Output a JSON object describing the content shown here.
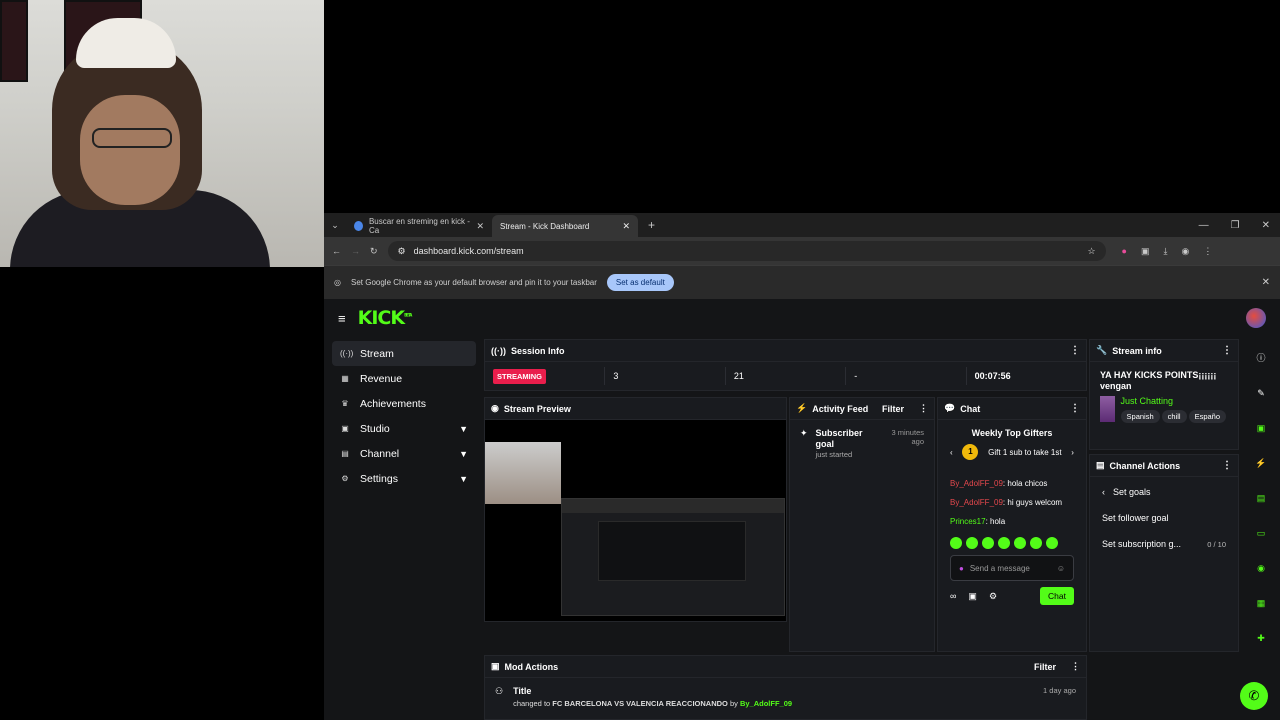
{
  "browser": {
    "tabs": [
      {
        "title": "Buscar en streming en kick - Ca",
        "active": false
      },
      {
        "title": "Stream - Kick Dashboard",
        "active": true
      }
    ],
    "url": "dashboard.kick.com/stream",
    "notice_text": "Set Google Chrome as your default browser and pin it to your taskbar",
    "notice_button": "Set as default"
  },
  "kick": {
    "logo": "KICK",
    "logo_badge": "BETA",
    "sidebar": [
      {
        "label": "Stream",
        "icon": "radio-icon",
        "active": true
      },
      {
        "label": "Revenue",
        "icon": "chart-icon"
      },
      {
        "label": "Achievements",
        "icon": "trophy-icon"
      },
      {
        "label": "Studio",
        "icon": "studio-icon",
        "expand": true
      },
      {
        "label": "Channel",
        "icon": "channel-icon",
        "expand": true
      },
      {
        "label": "Settings",
        "icon": "gear-icon",
        "expand": true
      }
    ],
    "session": {
      "title": "Session Info",
      "status": "STREAMING",
      "viewers": "3",
      "followers": "21",
      "subs": "-",
      "uptime": "00:07:56"
    },
    "preview": {
      "title": "Stream Preview"
    },
    "activity": {
      "title": "Activity Feed",
      "filter": "Filter",
      "item_title": "Subscriber goal",
      "item_sub": "just started",
      "item_time": "3 minutes ago"
    },
    "chat": {
      "title": "Chat",
      "gifters_title": "Weekly Top Gifters",
      "gift_text": "Gift 1 sub to take 1st",
      "rank": "1",
      "messages": [
        {
          "user": "By_AdolFF_09",
          "text": ": hola chicos"
        },
        {
          "user": "By_AdolFF_09",
          "text": ": hi guys welcom"
        },
        {
          "user": "Princes17",
          "text": ": hola"
        }
      ],
      "placeholder": "Send a message",
      "send_button": "Chat"
    },
    "stream_info": {
      "title": "Stream info",
      "stream_title": "YA HAY KICKS POINTS¡¡¡¡¡¡ vengan",
      "category": "Just Chatting",
      "tags": [
        "Spanish",
        "chill",
        "Españo"
      ],
      "edit": "Edit"
    },
    "channel_actions": {
      "title": "Channel Actions",
      "back_label": "Set goals",
      "items": [
        {
          "label": "Set follower goal",
          "progress": ""
        },
        {
          "label": "Set subscription g...",
          "progress": "0 / 10"
        }
      ]
    },
    "mod_actions": {
      "title": "Mod Actions",
      "filter": "Filter",
      "row_title": "Title",
      "row_prefix": "changed to",
      "row_value": "FC BARCELONA VS VALENCIA REACCIONANDO",
      "row_by": "by",
      "row_user": "By_AdolFF_09",
      "row_time": "1 day ago"
    }
  }
}
